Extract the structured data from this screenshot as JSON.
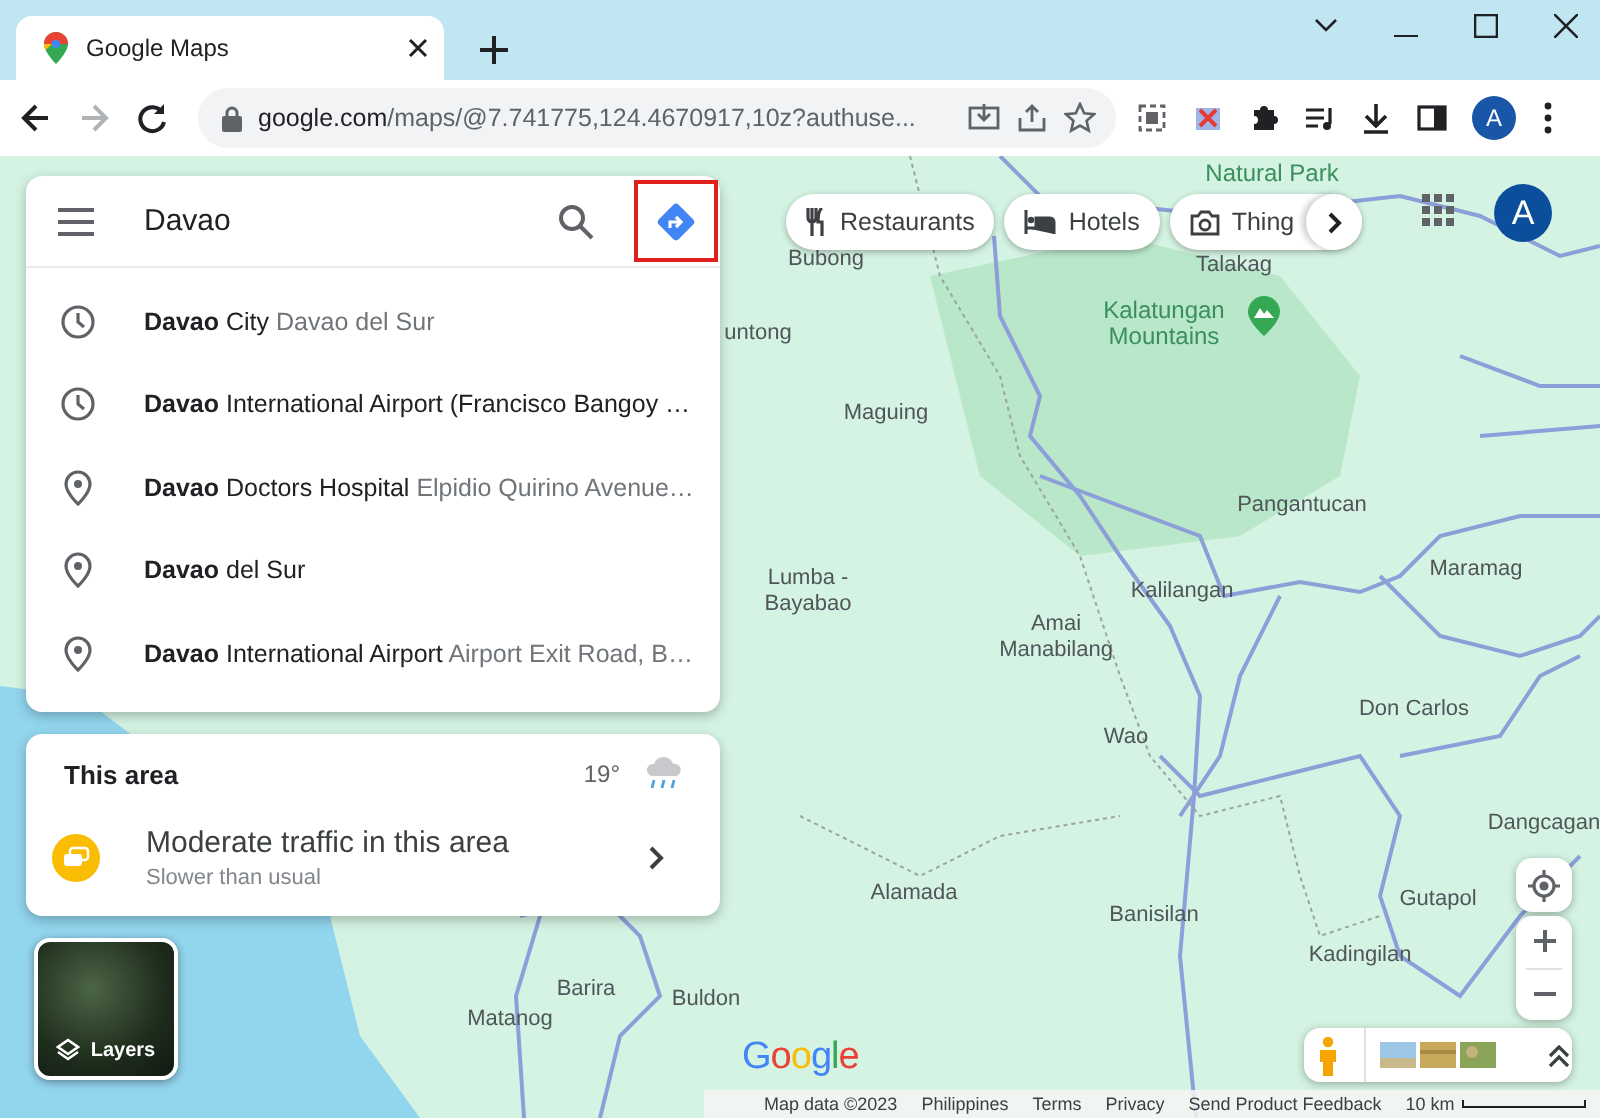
{
  "browser": {
    "tab": {
      "title": "Google Maps"
    },
    "nav": [
      {
        "kind": "back",
        "disabled": false
      },
      {
        "kind": "forward",
        "disabled": true
      },
      {
        "kind": "reload",
        "disabled": false
      }
    ],
    "url": {
      "host": "google.com",
      "path": "/maps/@7.741775,124.4670917,10z?authuse..."
    },
    "profile": "A"
  },
  "search": {
    "value": "Davao",
    "directions_highlighted": true,
    "suggestions": [
      {
        "kind": "recent",
        "primary": "**Davao** City",
        "secondary": "Davao del Sur"
      },
      {
        "kind": "recent",
        "primary": "**Davao** International Airport (Francisco Bangoy …"
      },
      {
        "kind": "place",
        "primary": "**Davao** Doctors Hospital",
        "secondary": "Elpidio Quirino Avenue…"
      },
      {
        "kind": "place",
        "primary": "**Davao** del Sur"
      },
      {
        "kind": "place",
        "primary": "**Davao** International Airport",
        "secondary": "Airport Exit Road, B…"
      }
    ]
  },
  "chips": [
    {
      "kind": "restaurants",
      "label": "Restaurants"
    },
    {
      "kind": "hotels",
      "label": "Hotels"
    },
    {
      "kind": "things",
      "label": "Thing"
    }
  ],
  "account": {
    "initial": "A"
  },
  "area": {
    "title": "This area",
    "temperature": "19°",
    "traffic": {
      "title": "Moderate traffic in this area",
      "subtitle": "Slower than usual"
    }
  },
  "layers": {
    "label": "Layers"
  },
  "map_labels": [
    {
      "name": "Natural Park",
      "kind": "park"
    },
    {
      "name": "Talakag",
      "kind": "town"
    },
    {
      "name": "Bubong",
      "kind": "town"
    },
    {
      "name": "untong",
      "kind": "town"
    },
    {
      "name": "Kalatungan Mountains",
      "kind": "park"
    },
    {
      "name": "Maguing",
      "kind": "town"
    },
    {
      "name": "Pangantucan",
      "kind": "town"
    },
    {
      "name": "Maramag",
      "kind": "town"
    },
    {
      "name": "Lumba - Bayabao",
      "kind": "town"
    },
    {
      "name": "Kalilangan",
      "kind": "town"
    },
    {
      "name": "Amai Manabilang",
      "kind": "town"
    },
    {
      "name": "Wao",
      "kind": "town"
    },
    {
      "name": "Don Carlos",
      "kind": "town"
    },
    {
      "name": "Dangcagan",
      "kind": "town"
    },
    {
      "name": "Alamada",
      "kind": "town"
    },
    {
      "name": "Banisilan",
      "kind": "town"
    },
    {
      "name": "Gutapol",
      "kind": "town"
    },
    {
      "name": "Kadingilan",
      "kind": "town"
    },
    {
      "name": "Barira",
      "kind": "town"
    },
    {
      "name": "Buldon",
      "kind": "town"
    },
    {
      "name": "Matanog",
      "kind": "town"
    }
  ],
  "logo": "Google",
  "footer": [
    "Map data ©2023",
    "Philippines",
    "Terms",
    "Privacy",
    "Send Product Feedback"
  ],
  "scale": "10 km"
}
